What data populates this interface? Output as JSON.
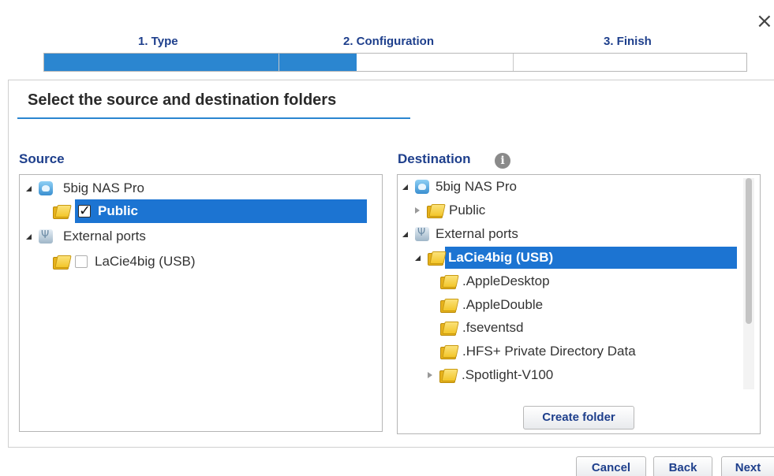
{
  "window": {
    "close_glyph": "×"
  },
  "steps": [
    {
      "label": "1. Type"
    },
    {
      "label": "2. Configuration"
    },
    {
      "label": "3. Finish"
    }
  ],
  "progress": {
    "segments_filled": [
      1.0,
      0.33,
      0.0
    ],
    "fill_color": "#2b86d0"
  },
  "panel": {
    "title": "Select the source and destination folders"
  },
  "source": {
    "label": "Source",
    "tree": [
      {
        "label": "5big NAS Pro",
        "icon": "nas-icon",
        "expanded": true
      },
      {
        "label": "Public",
        "icon": "folder-icon",
        "checked": true,
        "selected": true
      },
      {
        "label": "External ports",
        "icon": "usb-icon",
        "expanded": true
      },
      {
        "label": "LaCie4big (USB)",
        "icon": "folder-icon",
        "checked": false
      }
    ]
  },
  "destination": {
    "label": "Destination",
    "info_glyph": "i",
    "tree": [
      {
        "label": "5big NAS Pro",
        "icon": "nas-icon",
        "expanded": true
      },
      {
        "label": "Public",
        "icon": "folder-icon",
        "expanded": false
      },
      {
        "label": "External ports",
        "icon": "usb-icon",
        "expanded": true
      },
      {
        "label": "LaCie4big (USB)",
        "icon": "folder-icon",
        "expanded": true,
        "selected": true
      },
      {
        "label": ".AppleDesktop",
        "icon": "folder-icon"
      },
      {
        "label": ".AppleDouble",
        "icon": "folder-icon"
      },
      {
        "label": ".fseventsd",
        "icon": "folder-icon"
      },
      {
        "label": ".HFS+ Private Directory Data",
        "icon": "folder-icon"
      },
      {
        "label": ".Spotlight-V100",
        "icon": "folder-icon",
        "expanded": false
      }
    ],
    "create_folder_label": "Create folder"
  },
  "footer": {
    "cancel_label": "Cancel",
    "back_label": "Back",
    "next_label": "Next"
  },
  "colors": {
    "accent": "#2b86d0",
    "selection": "#1c74d2",
    "label_blue": "#1e3f8c"
  }
}
